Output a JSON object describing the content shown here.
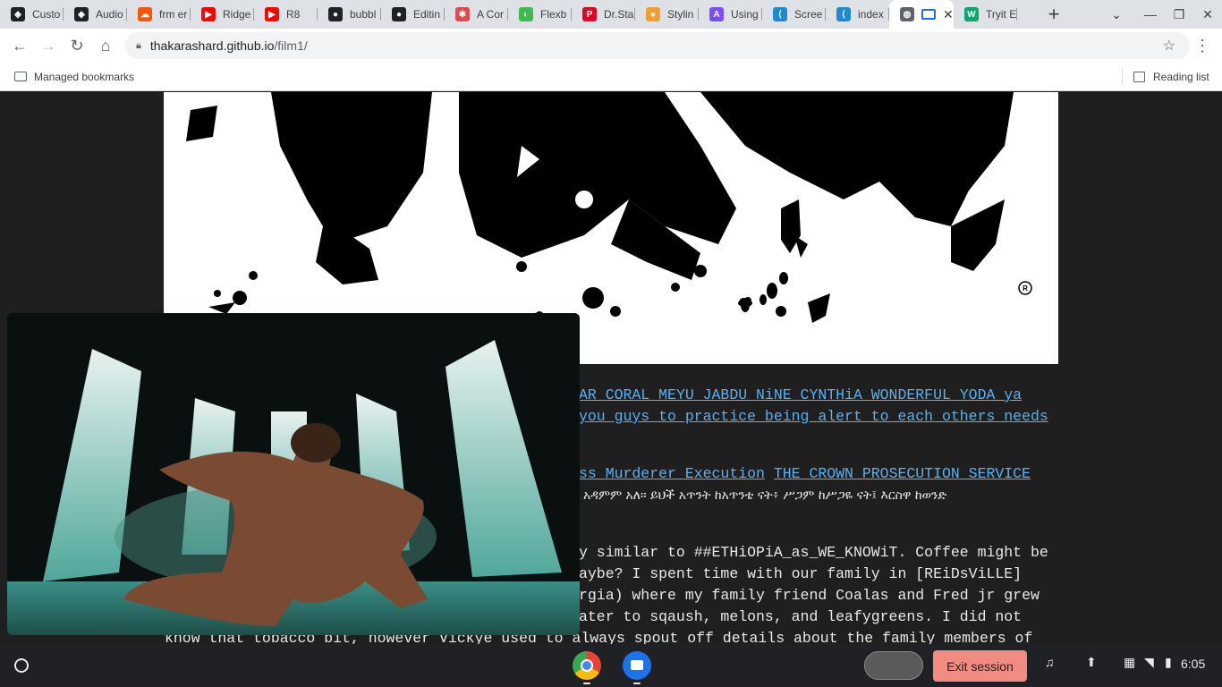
{
  "tabs": [
    {
      "title": "Custo",
      "icon": "codepen-icon",
      "color": "#202124"
    },
    {
      "title": "Audio",
      "icon": "codepen-icon",
      "color": "#202124"
    },
    {
      "title": "frm er",
      "icon": "soundcloud-icon",
      "color": "#ff5500"
    },
    {
      "title": "Ridge",
      "icon": "youtube-icon",
      "color": "#ff0000"
    },
    {
      "title": "R8",
      "icon": "youtube-icon",
      "color": "#ff0000"
    },
    {
      "title": "bubbl",
      "icon": "github-icon",
      "color": "#202124"
    },
    {
      "title": "Editin",
      "icon": "github-icon",
      "color": "#202124"
    },
    {
      "title": "A Cor",
      "icon": "asterisk-icon",
      "color": "#e5484d"
    },
    {
      "title": "Flexb",
      "icon": "frog-icon",
      "color": "#3fb950"
    },
    {
      "title": "Dr.Sta",
      "icon": "pinterest-icon",
      "color": "#e60023"
    },
    {
      "title": "Stylin",
      "icon": "circle-icon",
      "color": "#f0a030"
    },
    {
      "title": "Using",
      "icon": "bookmark-app-icon",
      "color": "#7c4dff"
    },
    {
      "title": "Scree",
      "icon": "vscode-icon",
      "color": "#1f8ad2"
    },
    {
      "title": "index",
      "icon": "vscode-icon",
      "color": "#1f8ad2"
    },
    {
      "title": "",
      "icon": "globe-icon",
      "color": "#5f6368",
      "active": true
    },
    {
      "title": "Tryit E",
      "icon": "w3schools-icon",
      "color": "#04aa6d"
    }
  ],
  "url": {
    "host": "thakarashard.github.io",
    "path": "/film1/"
  },
  "bookmarks": {
    "managed": "Managed bookmarks",
    "reading_list": "Reading list"
  },
  "content": {
    "line1": "AR CORAL MEYU JABDU NiNE CYNTHiA WONDERFUL YODA ya",
    "line2": " you guys to practice being alert to each others needs",
    "line3a": "ss Murderer Execution",
    "line3b": "THE CROWN PROSECUTION SERVICE",
    "line4": "አዳምም አለ። ይህች አጥንት ከአጥንቴ ናት፥ ሥጋም ከሥጋዬ ናት፤ እርስዋ ከወንድ",
    "line5": "y similar to ##ETHiOPiA_as_WE_KNOWiT. Coffee might be",
    "line6": "aybe? I spent time with our family in [REiDsViLLE]",
    "line7": "rgia) where my family friend Coalas and Fred jr grew",
    "line8": "ater to sqaush, melons, and leafygreens. I did not",
    "line9": "know that tobacco bit, however Vickye used to always spout off details about the family members of"
  },
  "shelf": {
    "exit_session": "Exit session",
    "time": "6:05"
  }
}
